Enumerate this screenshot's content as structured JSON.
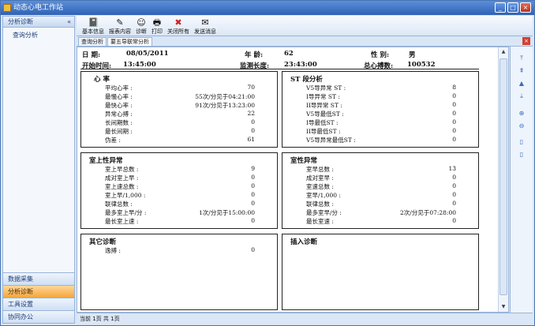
{
  "window": {
    "title": "动态心电工作站",
    "buttons": [
      "_",
      "□",
      "×"
    ]
  },
  "sidebar": {
    "header": "分析诊断",
    "collapse": "«",
    "items": [
      {
        "label": "查询分析"
      }
    ],
    "bottom": [
      {
        "label": "数据采集",
        "active": false
      },
      {
        "label": "分析诊断",
        "active": true
      },
      {
        "label": "工具设置",
        "active": false
      },
      {
        "label": "协同办公",
        "active": false
      }
    ]
  },
  "toolbar": {
    "buttons": [
      {
        "label": "基本信息",
        "icon": "notebook-icon"
      },
      {
        "label": "报表内容",
        "icon": "pen-icon"
      },
      {
        "label": "诊断",
        "icon": "doctor-icon"
      },
      {
        "label": "打印",
        "icon": "printer-icon"
      },
      {
        "label": "关闭所有",
        "icon": "close-all-icon"
      },
      {
        "label": "发送消息",
        "icon": "message-icon"
      }
    ]
  },
  "tabs": [
    {
      "label": "查询分析",
      "active": false
    },
    {
      "label": "要五导联常分析",
      "active": true
    }
  ],
  "report": {
    "date_label": "日  期:",
    "date": "08/05/2011",
    "age_label": "年  龄:",
    "age": "62",
    "sex_label": "性  别:",
    "sex": "男",
    "start_label": "开始时间:",
    "start": "13:45:00",
    "duration_label": "监测长度:",
    "duration": "23:43:00",
    "beats_label": "总心搏数:",
    "beats": "100532",
    "heart_rate": {
      "title": "心    率",
      "rows": [
        {
          "k": "平均心率 :",
          "v": "70"
        },
        {
          "k": "最慢心率 :",
          "v": "55次/分见于04:21:00"
        },
        {
          "k": "最快心率 :",
          "v": "91次/分见于13:23:00"
        },
        {
          "k": "异常心搏 :",
          "v": "22"
        },
        {
          "k": "长间期数 :",
          "v": "0"
        },
        {
          "k": "最长间期 :",
          "v": "0"
        },
        {
          "k": "伪差 :",
          "v": "61"
        }
      ]
    },
    "st": {
      "title": "ST 段分析",
      "rows": [
        {
          "k": "V5导异常 ST :",
          "v": "8"
        },
        {
          "k": "I导异常 ST :",
          "v": "0"
        },
        {
          "k": "II导异常 ST :",
          "v": "0"
        },
        {
          "k": "V5导最低ST :",
          "v": "0"
        },
        {
          "k": "I导最低ST :",
          "v": "0"
        },
        {
          "k": "II导最低ST :",
          "v": "0"
        },
        {
          "k": "V5导异常最低ST :",
          "v": "0"
        }
      ]
    },
    "supra": {
      "title": "室上性异常",
      "rows": [
        {
          "k": "室上早总数 :",
          "v": "9"
        },
        {
          "k": "成对室上早 :",
          "v": "0"
        },
        {
          "k": "室上速总数 :",
          "v": "0"
        },
        {
          "k": "室上早/1,000 :",
          "v": "0"
        },
        {
          "k": "联律总数 :",
          "v": "0"
        },
        {
          "k": "最多室上早/分 :",
          "v": "1次/分见于15:00:00"
        },
        {
          "k": "最长室上速 :",
          "v": "0"
        }
      ]
    },
    "vent": {
      "title": "室性异常",
      "rows": [
        {
          "k": "室早总数 :",
          "v": "13"
        },
        {
          "k": "成对室早 :",
          "v": "0"
        },
        {
          "k": "室速总数 :",
          "v": "0"
        },
        {
          "k": "室早/1,000 :",
          "v": "0"
        },
        {
          "k": "联律总数 :",
          "v": "0"
        },
        {
          "k": "最多室早/分 :",
          "v": "2次/分见于07:28:00"
        },
        {
          "k": "最长室速 :",
          "v": "0"
        }
      ]
    },
    "other": {
      "title": "其它诊断",
      "rows": [
        {
          "k": "逸搏 :",
          "v": "0"
        }
      ]
    },
    "insert": {
      "title": "插入诊断"
    }
  },
  "status": {
    "text": "当前 1页    共  1页"
  }
}
